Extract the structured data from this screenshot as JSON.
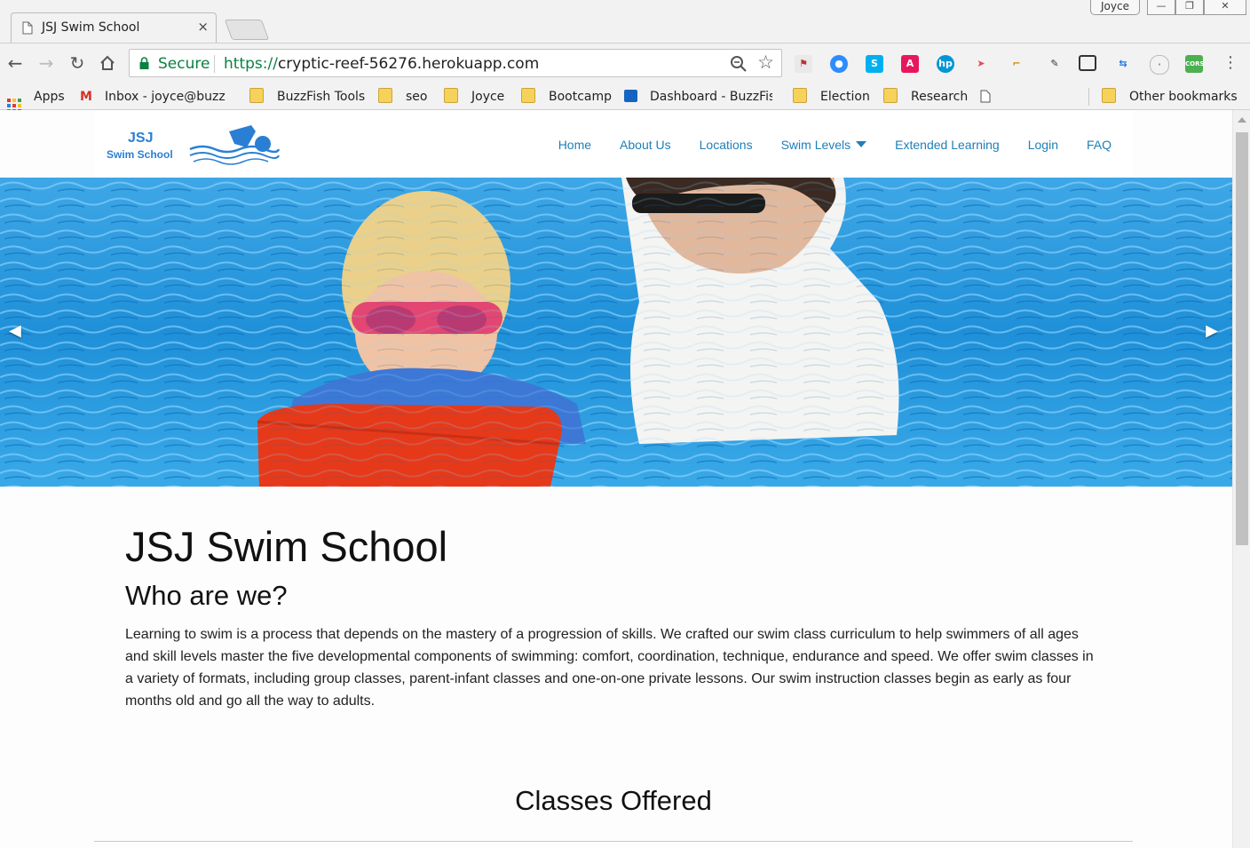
{
  "browser": {
    "tab_title": "JSJ Swim School",
    "tab_close": "×",
    "profile_name": "Joyce",
    "window_controls": [
      "—",
      "❐",
      "✕"
    ],
    "secure_label": "Secure",
    "url_scheme": "https://",
    "url_host": "cryptic-reef-56276.herokuapp.com"
  },
  "bookmarks": {
    "apps": "Apps",
    "gmail": "Inbox - joyce@buzzf",
    "items": [
      "BuzzFish Tools",
      "seo",
      "Joyce",
      "Bootcamp"
    ],
    "dashboard": "Dashboard - BuzzFis",
    "items2": [
      "Election",
      "Research"
    ],
    "other": "Other bookmarks"
  },
  "extensions": [
    "acrobat",
    "zoom",
    "skype",
    "a",
    "hp",
    "cast",
    "ruler",
    "eyedropper",
    "screenshot",
    "shuffle",
    "console",
    "CORS"
  ],
  "site": {
    "logo_line1": "JSJ",
    "logo_line2": "Swim School",
    "nav": {
      "home": "Home",
      "about": "About Us",
      "locations": "Locations",
      "swim_levels": "Swim Levels",
      "extended": "Extended Learning",
      "login": "Login",
      "faq": "FAQ"
    },
    "carousel": {
      "prev": "◀",
      "next": "▶"
    },
    "heading": "JSJ Swim School",
    "subheading": "Who are we?",
    "body": "Learning to swim is a process that depends on the mastery of a progression of skills. We crafted our swim class curriculum to help swimmers of all ages and skill levels master the five developmental components of swimming: comfort, coordination, technique, endurance and speed. We offer swim classes in a variety of formats, including group classes, parent-infant classes and one-on-one private lessons. Our swim instruction classes begin as early as four months old and go all the way to adults.",
    "classes_title": "Classes Offered"
  },
  "colors": {
    "link": "#1f7fb8",
    "logo_blue": "#2a7fd4",
    "secure_green": "#0b8043"
  }
}
